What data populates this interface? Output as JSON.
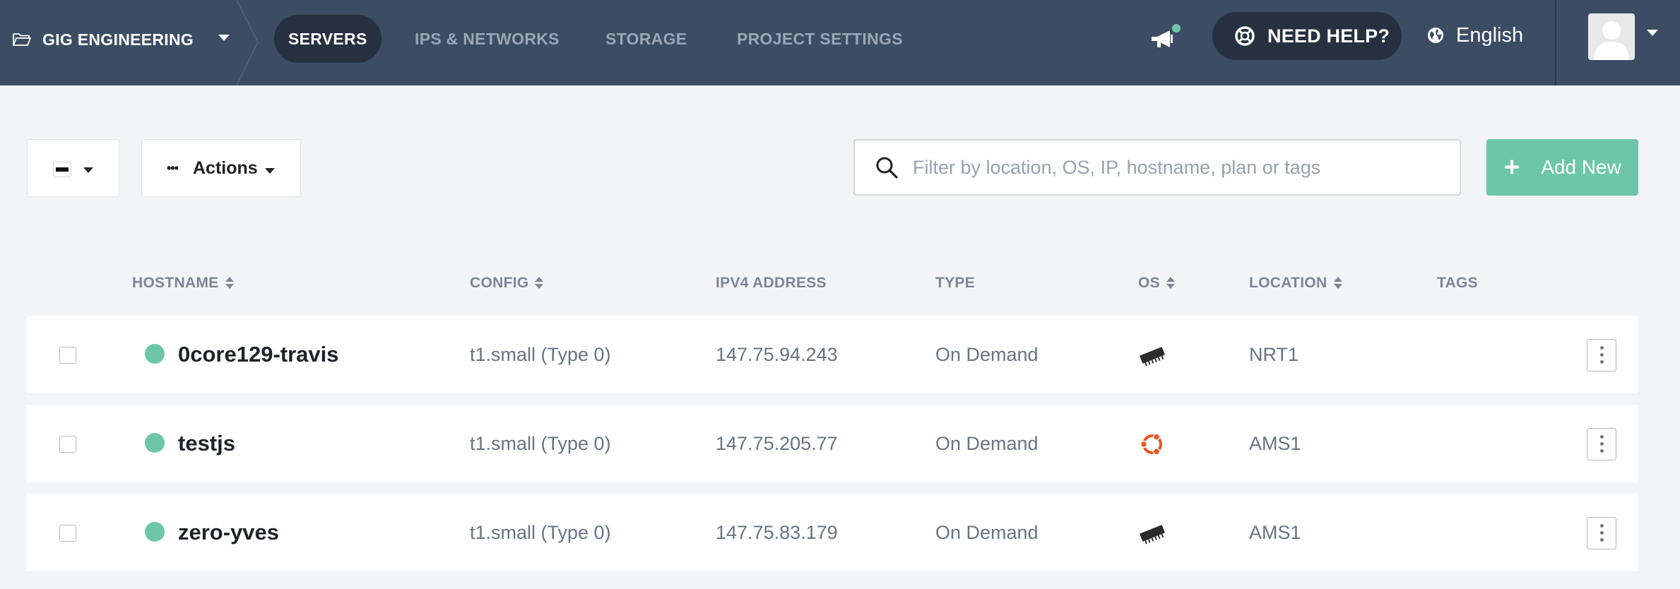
{
  "header": {
    "project_name": "GIG ENGINEERING",
    "tabs": [
      {
        "label": "SERVERS",
        "active": true
      },
      {
        "label": "IPS & NETWORKS",
        "active": false
      },
      {
        "label": "STORAGE",
        "active": false
      },
      {
        "label": "PROJECT SETTINGS",
        "active": false
      }
    ],
    "help_label": "NEED HELP?",
    "language": "English",
    "notification_dot": true
  },
  "toolbar": {
    "actions_label": "Actions",
    "search_placeholder": "Filter by location, OS, IP, hostname, plan or tags",
    "search_value": "",
    "add_label": "Add New"
  },
  "table": {
    "columns": [
      {
        "label": "HOSTNAME",
        "sortable": true
      },
      {
        "label": "CONFIG",
        "sortable": true
      },
      {
        "label": "IPV4 ADDRESS",
        "sortable": false
      },
      {
        "label": "TYPE",
        "sortable": false
      },
      {
        "label": "OS",
        "sortable": true
      },
      {
        "label": "LOCATION",
        "sortable": true
      },
      {
        "label": "TAGS",
        "sortable": false
      }
    ],
    "rows": [
      {
        "hostname": "0core129-travis",
        "config": "t1.small (Type 0)",
        "ipv4": "147.75.94.243",
        "type": "On Demand",
        "os_icon": "chip-icon",
        "location": "NRT1",
        "status": "active"
      },
      {
        "hostname": "testjs",
        "config": "t1.small (Type 0)",
        "ipv4": "147.75.205.77",
        "type": "On Demand",
        "os_icon": "ubuntu-icon",
        "location": "AMS1",
        "status": "active"
      },
      {
        "hostname": "zero-yves",
        "config": "t1.small (Type 0)",
        "ipv4": "147.75.83.179",
        "type": "On Demand",
        "os_icon": "chip-icon",
        "location": "AMS1",
        "status": "active"
      }
    ]
  },
  "colors": {
    "nav_bg": "#3c4c63",
    "nav_active": "#26303e",
    "accent_green": "#6dc6a8",
    "page_bg": "#f3f4f6",
    "ubuntu_orange": "#e95420"
  }
}
